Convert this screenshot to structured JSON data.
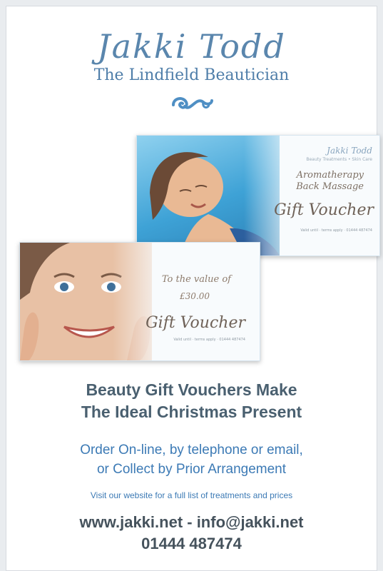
{
  "brand": {
    "name": "Jakki Todd",
    "subtitle": "The Lindfield Beautician"
  },
  "voucher_top": {
    "brand": "Jakki Todd",
    "brand_sub": "Beauty Treatments • Skin Care",
    "line1": "Aromatherapy",
    "line2": "Back Massage",
    "title": "Gift Voucher",
    "fine_print": "Valid until · terms apply · 01444 487474"
  },
  "voucher_bottom": {
    "to_value": "To the value of",
    "amount": "£30.00",
    "title": "Gift Voucher",
    "fine_print": "Valid until · terms apply · 01444 487474"
  },
  "copy": {
    "headline_line1": "Beauty Gift Vouchers Make",
    "headline_line2": "The Ideal Christmas Present",
    "order_line1": "Order On-line, by telephone or email,",
    "order_line2": "or Collect by Prior Arrangement",
    "website_note": "Visit our website for a full list of treatments and prices",
    "contact_line": "www.jakki.net - info@jakki.net",
    "phone": "01444 487474"
  },
  "colors": {
    "brand_blue": "#5a86ad",
    "headline_gray": "#4a6070",
    "accent_blue": "#3c7ab5"
  },
  "icons": {
    "ornament": "swirl-ornament-icon"
  }
}
